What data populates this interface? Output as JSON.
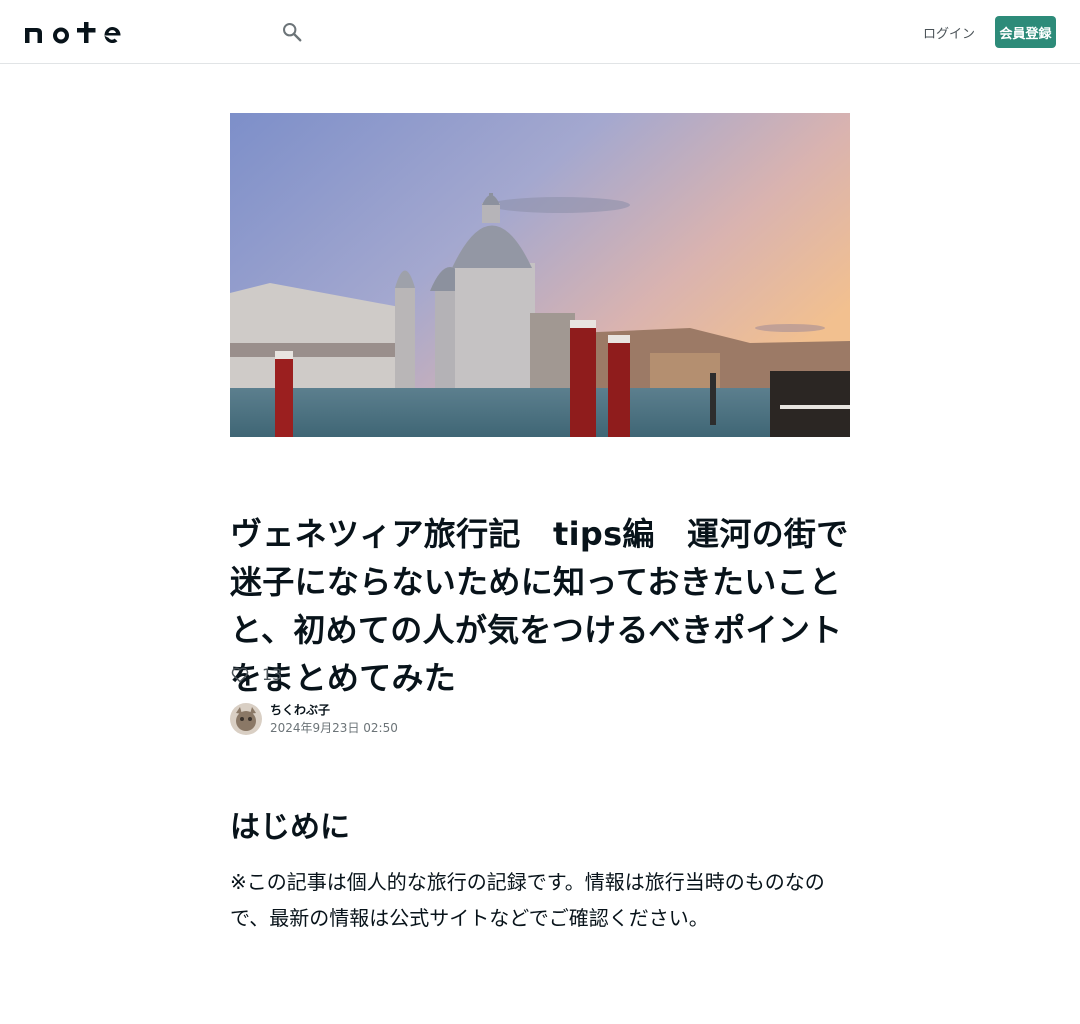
{
  "header": {
    "logo_text": "note",
    "search_icon": "search-icon",
    "login_label": "ログイン",
    "signup_label": "会員登録",
    "accent_color": "#2d8b79"
  },
  "hero": {
    "image": "venice-grand-canal-santa-maria-della-salute-sunset"
  },
  "article": {
    "title": "ヴェネツィア旅行記　tips編　運河の街で迷子にならないために知っておきたいことと、初めての人が気をつけるべきポイントをまとめてみた",
    "likes": "13",
    "like_icon": "heart-outline-icon",
    "author_name": "ちくわぶ子",
    "date": "2024年9月23日 02:50",
    "section_heading": "はじめに",
    "body": "※この記事は個人的な旅行の記録です。情報は旅行当時のものなので、最新の情報は公式サイトなどでご確認ください。"
  }
}
